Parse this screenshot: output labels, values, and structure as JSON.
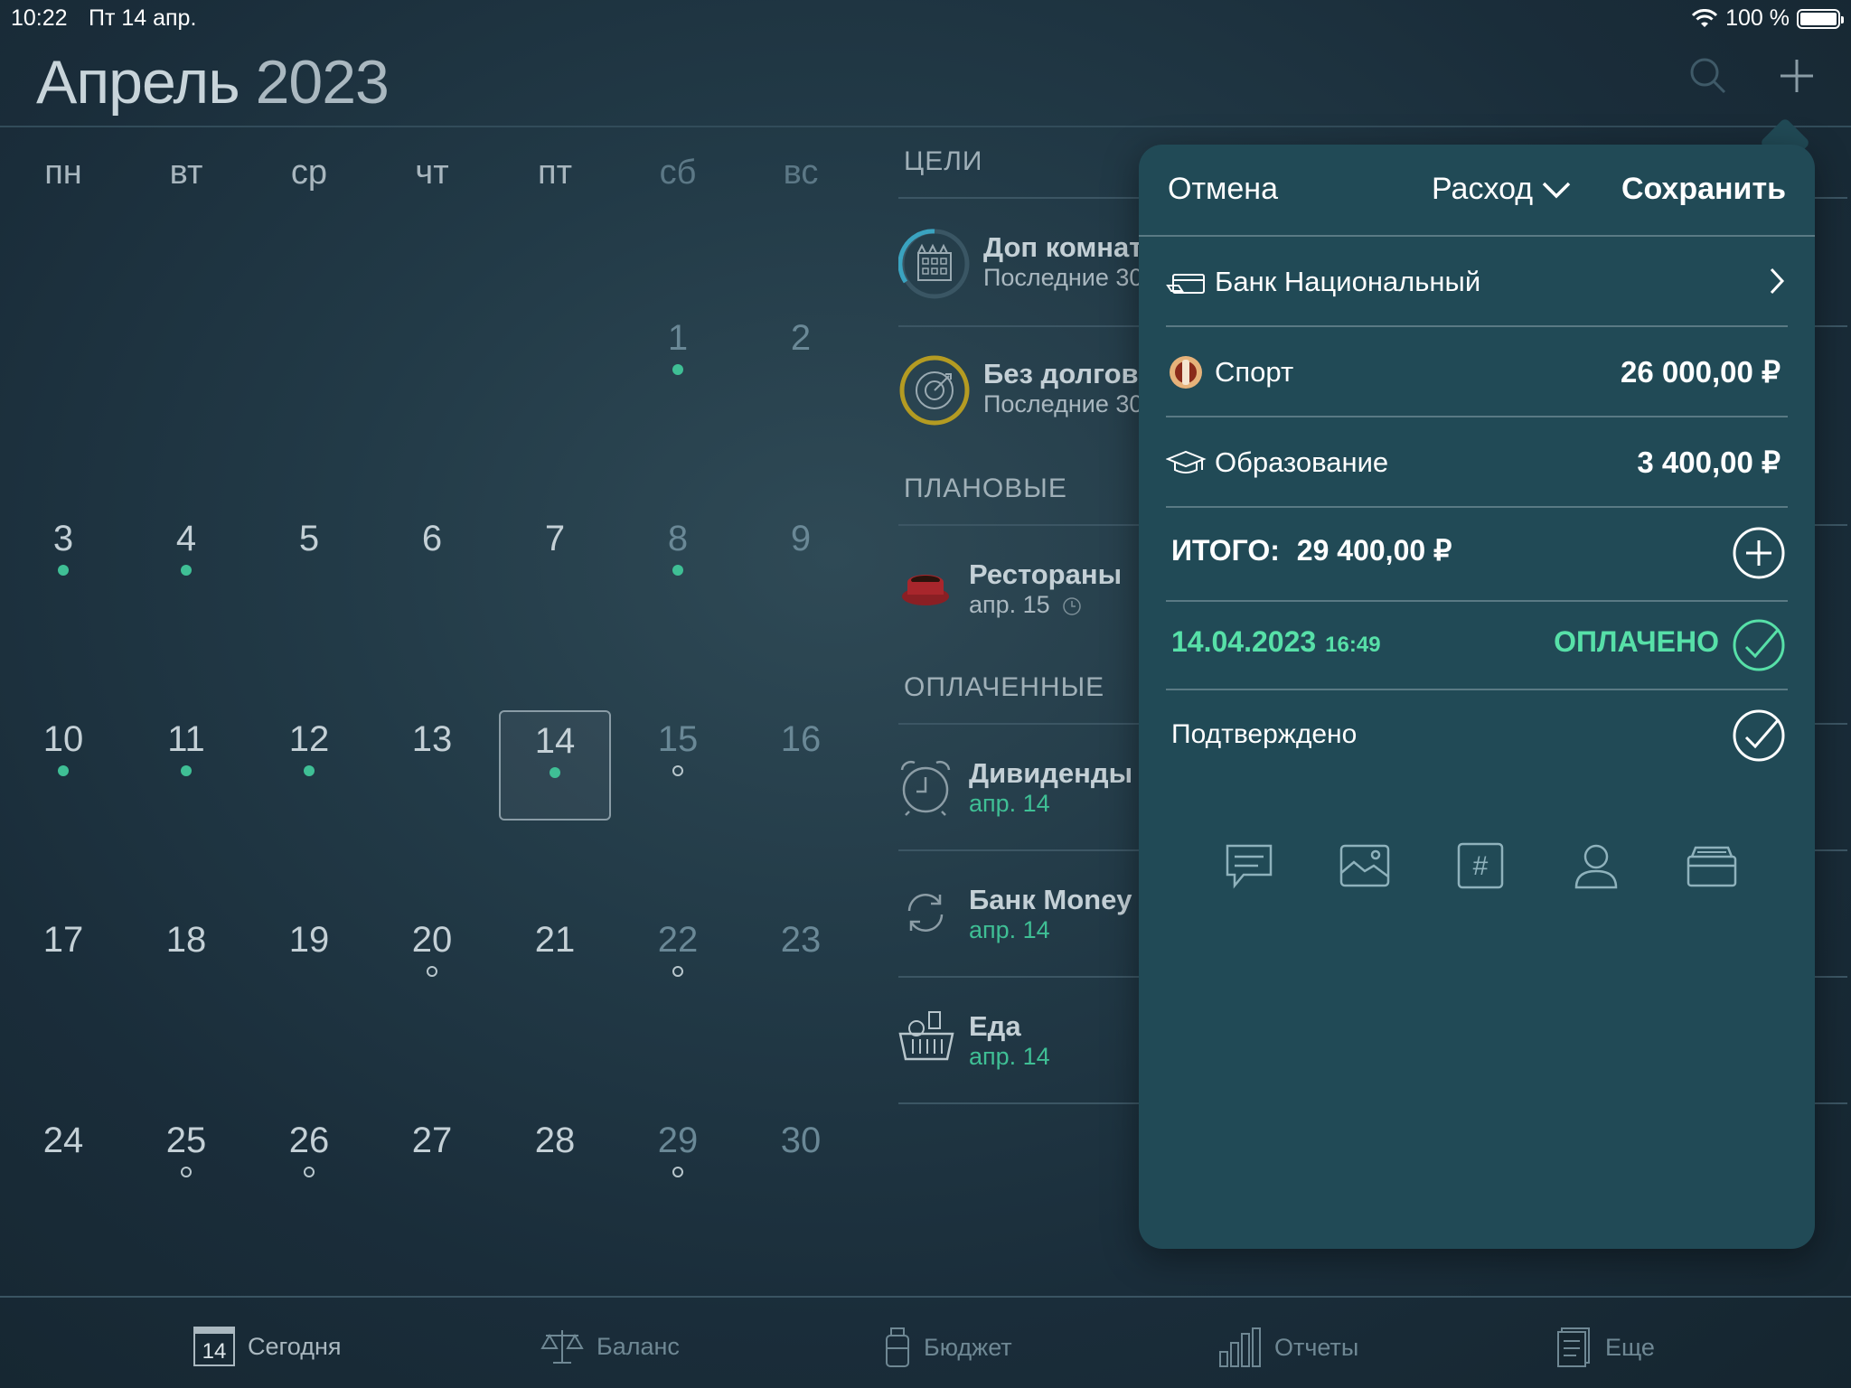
{
  "status": {
    "time": "10:22",
    "date": "Пт 14 апр.",
    "battery": "100 %"
  },
  "header": {
    "month": "Апрель",
    "year": "2023",
    "search_icon": "search-icon",
    "add_icon": "plus-icon"
  },
  "calendar": {
    "weekdays": [
      "пн",
      "вт",
      "ср",
      "чт",
      "пт",
      "сб",
      "вс"
    ],
    "weeks": [
      [
        null,
        null,
        null,
        null,
        null,
        {
          "day": "1",
          "mark": "filled"
        },
        {
          "day": "2"
        }
      ],
      [
        {
          "day": "3",
          "mark": "filled"
        },
        {
          "day": "4",
          "mark": "filled"
        },
        {
          "day": "5"
        },
        {
          "day": "6"
        },
        {
          "day": "7"
        },
        {
          "day": "8",
          "mark": "filled"
        },
        {
          "day": "9"
        }
      ],
      [
        {
          "day": "10",
          "mark": "filled"
        },
        {
          "day": "11",
          "mark": "filled"
        },
        {
          "day": "12",
          "mark": "filled"
        },
        {
          "day": "13"
        },
        {
          "day": "14",
          "mark": "filled",
          "today": true
        },
        {
          "day": "15",
          "mark": "hollow"
        },
        {
          "day": "16"
        }
      ],
      [
        {
          "day": "17"
        },
        {
          "day": "18"
        },
        {
          "day": "19"
        },
        {
          "day": "20",
          "mark": "hollow"
        },
        {
          "day": "21"
        },
        {
          "day": "22",
          "mark": "hollow"
        },
        {
          "day": "23"
        }
      ],
      [
        {
          "day": "24"
        },
        {
          "day": "25",
          "mark": "hollow"
        },
        {
          "day": "26",
          "mark": "hollow"
        },
        {
          "day": "27"
        },
        {
          "day": "28"
        },
        {
          "day": "29",
          "mark": "hollow"
        },
        {
          "day": "30"
        }
      ]
    ]
  },
  "sections": {
    "goals": "ЦЕЛИ",
    "planned": "ПЛАНОВЫЕ",
    "paid": "ОПЛАЧЕННЫЕ"
  },
  "goals": [
    {
      "title": "Доп комнат",
      "sub": "Последние 30",
      "icon": "building-icon"
    },
    {
      "title": "Без долгов",
      "sub": "Последние 30",
      "icon": "target-icon"
    }
  ],
  "planned": [
    {
      "title": "Рестораны",
      "sub": "апр. 15",
      "icon": "coffee-cup-icon"
    }
  ],
  "paid": [
    {
      "title": "Дивиденды",
      "sub": "апр. 14",
      "icon": "alarm-clock-icon"
    },
    {
      "title": "Банк Money I",
      "sub": "апр. 14",
      "icon": "refresh-icon"
    },
    {
      "title": "Еда",
      "sub": "апр. 14",
      "icon": "basket-icon"
    }
  ],
  "panel": {
    "cancel": "Отмена",
    "type": "Расход",
    "save": "Сохранить",
    "account": "Банк Национальный",
    "categories": [
      {
        "label": "Спорт",
        "amount": "26 000,00 ₽",
        "icon": "sport-icon"
      },
      {
        "label": "Образование",
        "amount": "3 400,00 ₽",
        "icon": "graduation-cap-icon"
      }
    ],
    "total_label": "ИТОГО:",
    "total_value": "29 400,00 ₽",
    "date": "14.04.2023",
    "time": "16:49",
    "paid_status": "ОПЛАЧЕНО",
    "confirmed": "Подтверждено",
    "accent_color": "#57e0a8"
  },
  "tabbar": [
    {
      "label": "Сегодня",
      "badge": "14",
      "icon": "calendar-icon",
      "active": true
    },
    {
      "label": "Баланс",
      "icon": "scales-icon"
    },
    {
      "label": "Бюджет",
      "icon": "jar-icon"
    },
    {
      "label": "Отчеты",
      "icon": "bar-chart-icon"
    },
    {
      "label": "Еще",
      "icon": "document-icon"
    }
  ]
}
